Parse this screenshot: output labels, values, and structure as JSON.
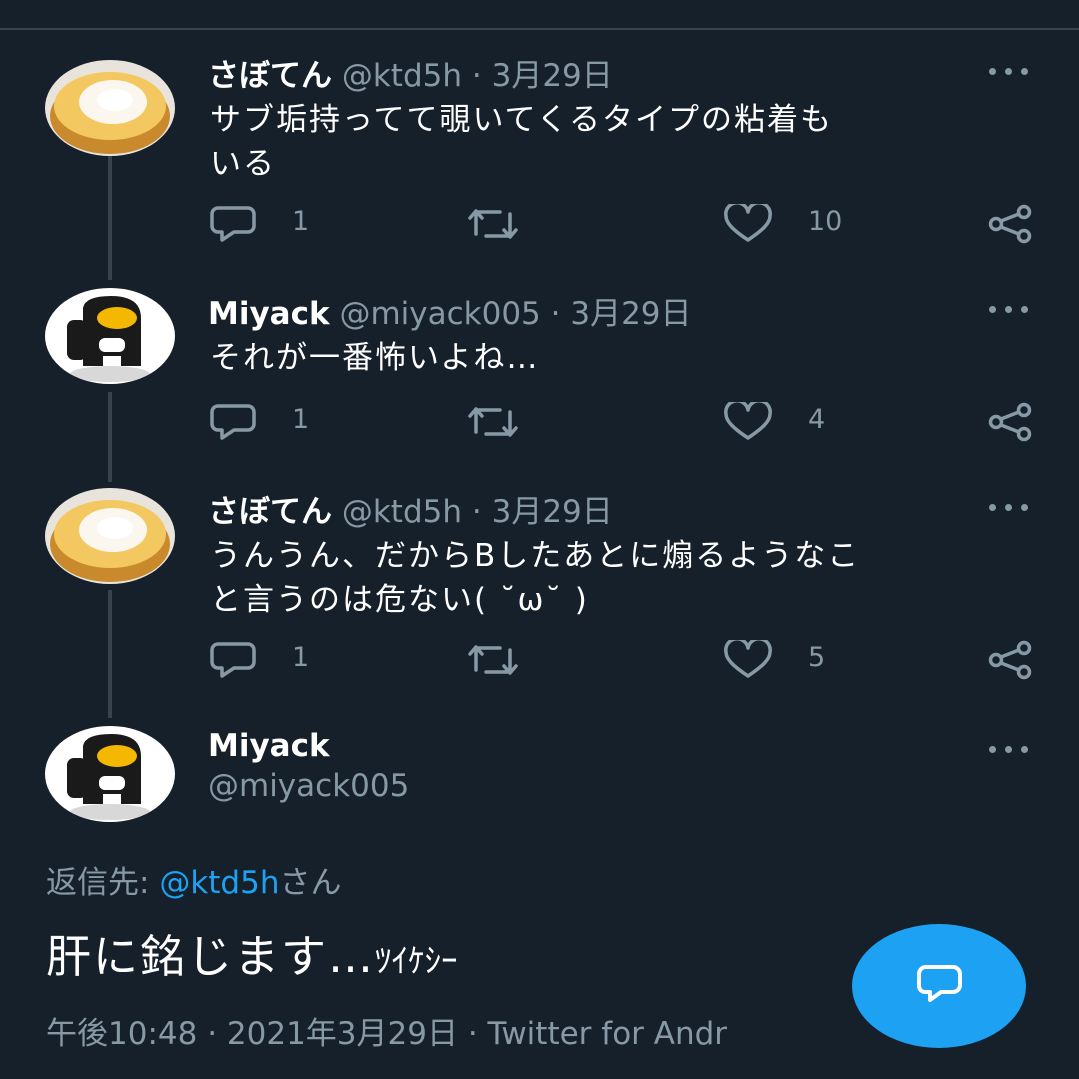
{
  "colors": {
    "background": "#15202b",
    "text": "#ffffff",
    "secondary": "#8899a6",
    "accent": "#1da1f2",
    "divider": "#38444d"
  },
  "tweets": [
    {
      "name": "さぼてん",
      "handle": "@ktd5h",
      "date": "3月29日",
      "separator": "·",
      "avatar": "swiss-roll-cake",
      "text_line1": "サブ垢持ってて覗いてくるタイプの粘着も",
      "text_line2": "いる",
      "replies": "1",
      "likes": "10"
    },
    {
      "name": "Miyack",
      "handle": "@miyack005",
      "date": "3月29日",
      "separator": "·",
      "avatar": "black-crewmate",
      "text_line1": "それが一番怖いよね…",
      "replies": "1",
      "likes": "4"
    },
    {
      "name": "さぼてん",
      "handle": "@ktd5h",
      "date": "3月29日",
      "separator": "·",
      "avatar": "swiss-roll-cake",
      "text_line1": "うんうん、だからBしたあとに煽るようなこ",
      "text_line2": "と言うのは危ない( ˘ω˘ )",
      "replies": "1",
      "likes": "5"
    }
  ],
  "main_tweet": {
    "name": "Miyack",
    "handle": "@miyack005",
    "avatar": "black-crewmate",
    "reply_to_label": "返信先: ",
    "reply_to_mention": "@ktd5h",
    "reply_to_suffix": "さん",
    "text": "肝に銘じます…",
    "text_small": "ﾂｲｹｼｰ",
    "timestamp_meta": "午後10:48 · 2021年3月29日 · Twitter for Andr"
  },
  "icons": {
    "reply": "reply-bubble-icon",
    "retweet": "retweet-icon",
    "like": "heart-icon",
    "share": "share-icon",
    "more": "more-dots-icon",
    "compose": "compose-reply-icon"
  }
}
